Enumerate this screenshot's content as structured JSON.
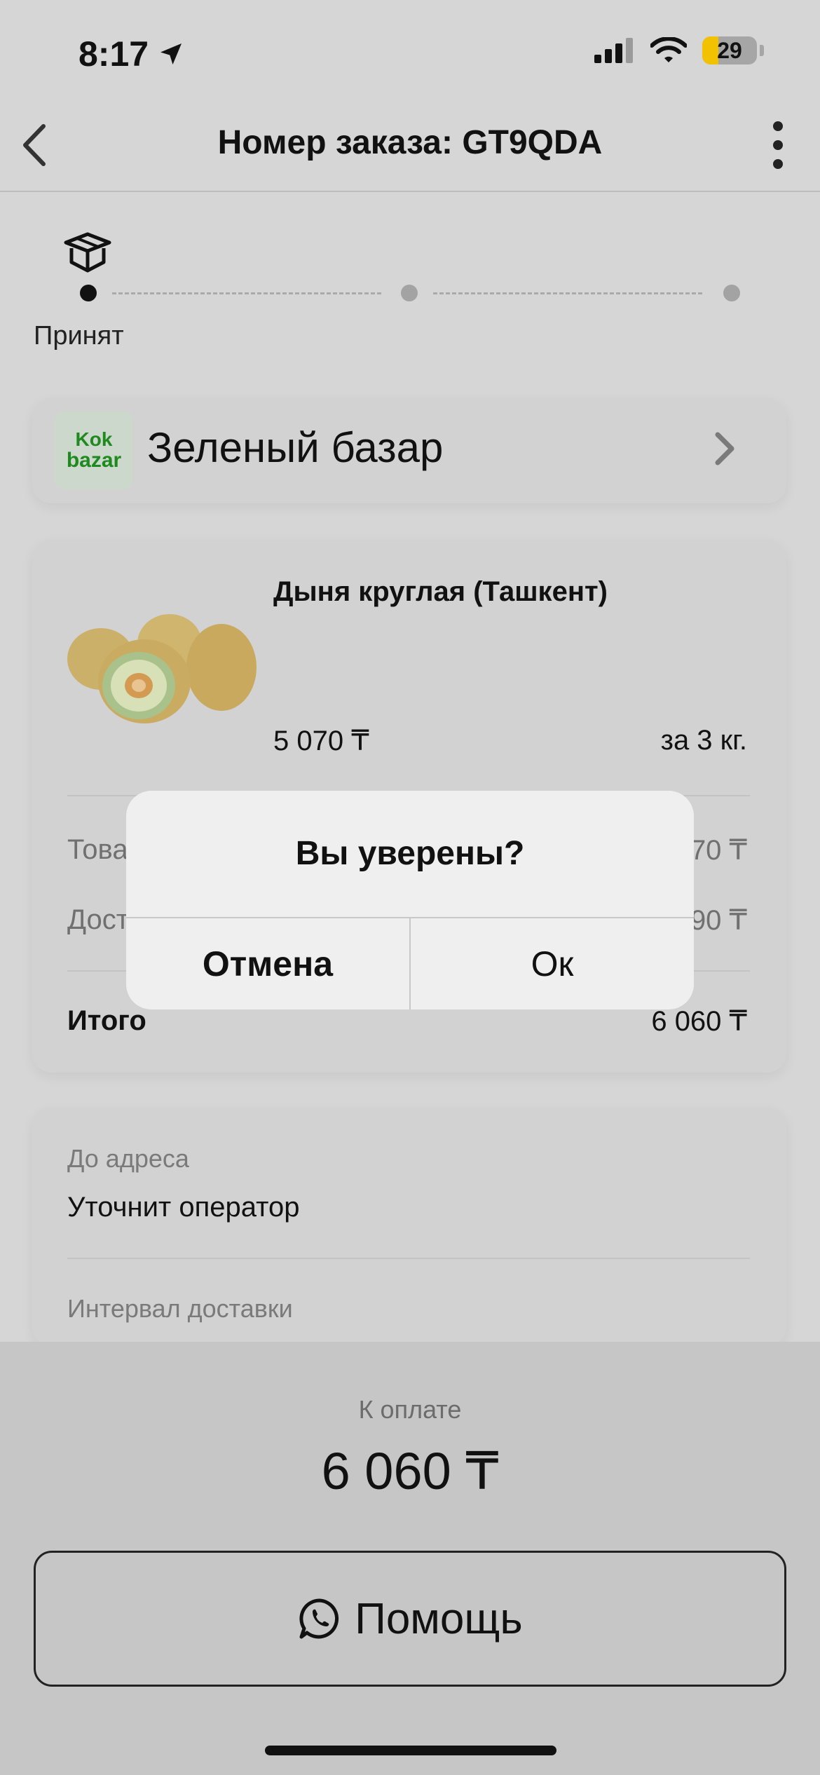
{
  "status_bar": {
    "time": "8:17",
    "battery": "29",
    "icons": [
      "location-arrow-icon",
      "cellular-signal-icon",
      "wifi-icon",
      "battery-icon"
    ]
  },
  "nav": {
    "title": "Номер заказа: GT9QDA",
    "back_icon": "chevron-left-icon",
    "more_icon": "vertical-ellipsis-icon"
  },
  "progress": {
    "icon": "box-icon",
    "current_step_label": "Принят",
    "steps_total": 3,
    "current_step": 1
  },
  "store": {
    "logo_line1": "Kok",
    "logo_line2": "bazar",
    "name": "Зеленый базар"
  },
  "order": {
    "item": {
      "name": "Дыня круглая (Ташкент)",
      "price": "5 070 ₸",
      "quantity": "за 3 кг."
    },
    "rows": [
      {
        "label": "Това",
        "value": "70 ₸"
      },
      {
        "label": "Дост",
        "value": "90 ₸"
      }
    ],
    "total_label": "Итого",
    "total_value": "6 060 ₸"
  },
  "delivery": {
    "address_label": "До адреса",
    "address_value": "Уточнит оператор",
    "interval_label": "Интервал доставки"
  },
  "payment": {
    "label": "К оплате",
    "amount": "6 060 ₸"
  },
  "help_button": {
    "label": "Помощь",
    "icon": "whatsapp-icon"
  },
  "alert": {
    "title": "Вы уверены?",
    "cancel_label": "Отмена",
    "ok_label": "Ок"
  },
  "colors": {
    "background": "#d6d6d6",
    "alert_background": "#efefef",
    "logo_green": "#1e8a1e",
    "battery_yellow": "#f2c200"
  }
}
